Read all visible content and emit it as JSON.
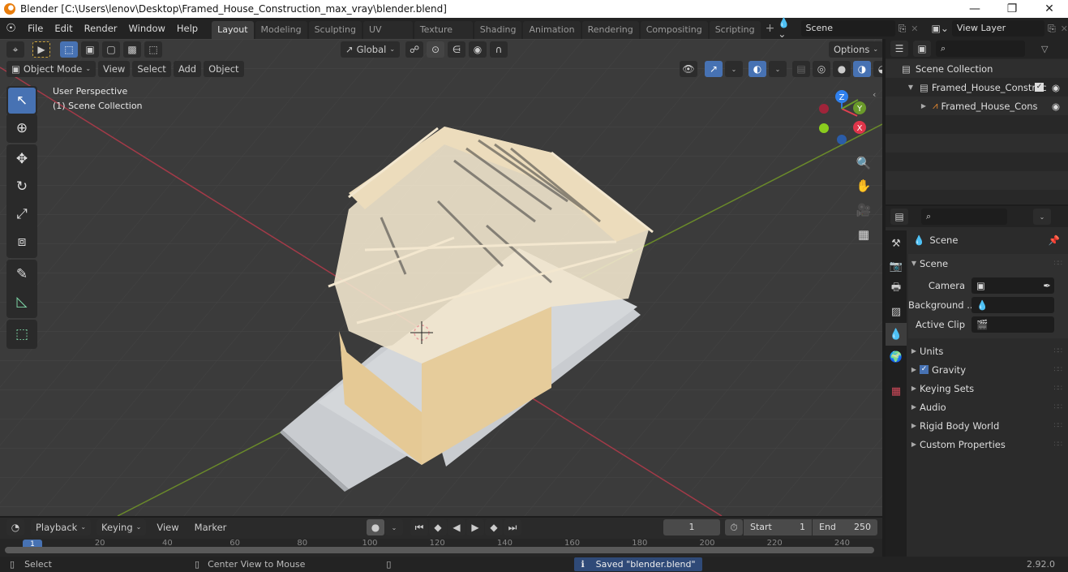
{
  "window": {
    "title": "Blender [C:\\Users\\lenov\\Desktop\\Framed_House_Construction_max_vray\\blender.blend]",
    "minimize": "—",
    "maximize": "❐",
    "close": "✕"
  },
  "menu": [
    "File",
    "Edit",
    "Render",
    "Window",
    "Help"
  ],
  "workspaces": [
    {
      "label": "Layout",
      "active": true
    },
    {
      "label": "Modeling"
    },
    {
      "label": "Sculpting"
    },
    {
      "label": "UV Editing"
    },
    {
      "label": "Texture Paint"
    },
    {
      "label": "Shading"
    },
    {
      "label": "Animation"
    },
    {
      "label": "Rendering"
    },
    {
      "label": "Compositing"
    },
    {
      "label": "Scripting"
    }
  ],
  "add_workspace": "+",
  "scene_field": "Scene",
  "view_layer_field": "View Layer",
  "viewport": {
    "transform_orientation": "Global",
    "options_label": "Options",
    "mode": "Object Mode",
    "menus": [
      "View",
      "Select",
      "Add",
      "Object"
    ],
    "overlay_line1": "User Perspective",
    "overlay_line2": "(1) Scene Collection",
    "gizmo": {
      "x": "X",
      "y": "Y",
      "z": "Z"
    },
    "colors": {
      "x_axis": "#a33a48",
      "y_axis": "#6a8a2a",
      "accent": "#4772b3",
      "wood": "#ecdcbc",
      "slab": "#c9ccd0"
    }
  },
  "tools": [
    {
      "name": "select-box-tool",
      "glyph": "↖",
      "active": true
    },
    {
      "name": "cursor-tool",
      "glyph": "⊕"
    },
    {
      "name": "move-tool",
      "glyph": "✥"
    },
    {
      "name": "rotate-tool",
      "glyph": "↻"
    },
    {
      "name": "scale-tool",
      "glyph": "⤢"
    },
    {
      "name": "transform-tool",
      "glyph": "⧈"
    },
    {
      "name": "annotate-tool",
      "glyph": "✎"
    },
    {
      "name": "measure-tool",
      "glyph": "◺"
    },
    {
      "name": "add-cube-tool",
      "glyph": "⬚"
    }
  ],
  "outliner": {
    "root": "Scene Collection",
    "items": [
      {
        "label": "Framed_House_Construc",
        "checked": true,
        "visible": true
      },
      {
        "label": "Framed_House_Cons",
        "visible": true
      }
    ]
  },
  "properties": {
    "context": "Scene",
    "panel_title": "Scene",
    "fields": [
      {
        "label": "Camera",
        "value": ""
      },
      {
        "label": "Background ...",
        "value": ""
      },
      {
        "label": "Active Clip",
        "value": ""
      }
    ],
    "sections": [
      {
        "label": "Units"
      },
      {
        "label": "Gravity",
        "checkbox": true
      },
      {
        "label": "Keying Sets"
      },
      {
        "label": "Audio"
      },
      {
        "label": "Rigid Body World"
      },
      {
        "label": "Custom Properties"
      }
    ]
  },
  "timeline": {
    "menus": [
      "Playback",
      "Keying",
      "View",
      "Marker"
    ],
    "current_frame": "1",
    "start_label": "Start",
    "start": "1",
    "end_label": "End",
    "end": "250",
    "ticks": [
      "20",
      "40",
      "60",
      "80",
      "100",
      "120",
      "140",
      "160",
      "180",
      "200",
      "220",
      "240"
    ],
    "playhead": "1"
  },
  "status": {
    "left_action": "Select",
    "middle_action": "Center View to Mouse",
    "message": "Saved \"blender.blend\"",
    "version": "2.92.0"
  }
}
